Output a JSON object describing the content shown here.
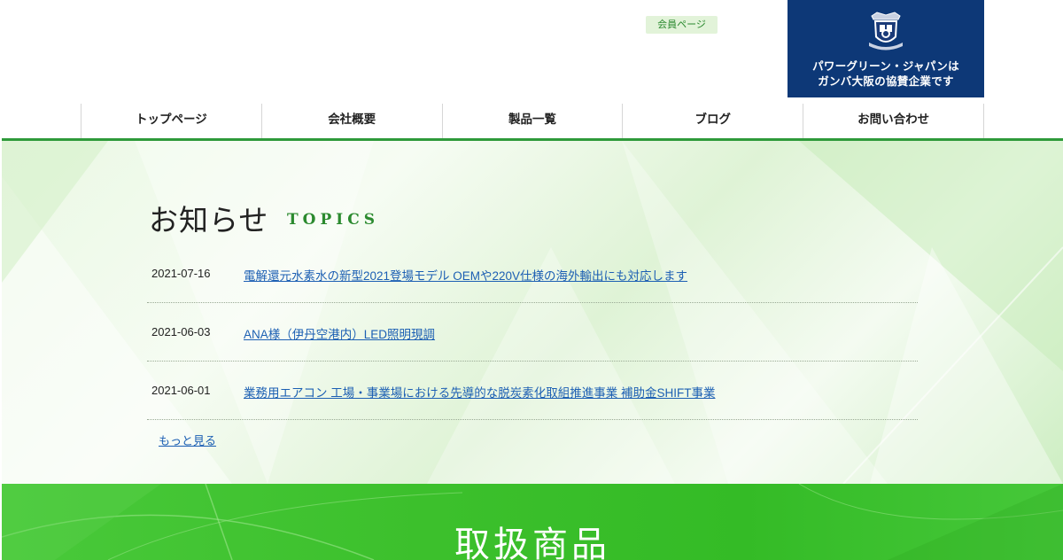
{
  "header": {
    "member_label": "会員ページ",
    "sponsor_line1": "パワーグリーン・ジャパンは",
    "sponsor_line2": "ガンバ大阪の協賛企業です"
  },
  "nav": {
    "items": [
      {
        "label": "トップページ"
      },
      {
        "label": "会社概要"
      },
      {
        "label": "製品一覧"
      },
      {
        "label": "ブログ"
      },
      {
        "label": "お問い合わせ"
      }
    ]
  },
  "topics": {
    "title": "お知らせ",
    "subtitle": "TOPICS",
    "news": [
      {
        "date": "2021-07-16",
        "title": "電解還元水素水の新型2021登場モデル OEMや220V仕様の海外輸出にも対応します"
      },
      {
        "date": "2021-06-03",
        "title": "ANA様（伊丹空港内）LED照明現調"
      },
      {
        "date": "2021-06-01",
        "title": "業務用エアコン 工場・事業場における先導的な脱炭素化取組推進事業 補助金SHIFT事業"
      }
    ],
    "more_label": "もっと見る"
  },
  "products": {
    "title": "取扱商品"
  },
  "colors": {
    "accent_green": "#2e9a3a",
    "sponsor_navy": "#0d3877",
    "link_blue": "#1c5fb3"
  }
}
